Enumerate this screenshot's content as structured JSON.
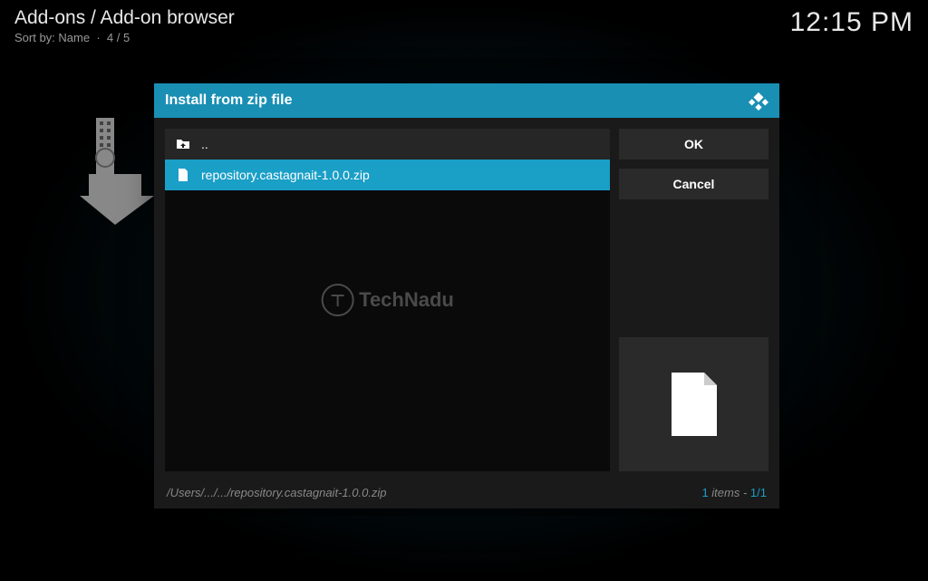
{
  "header": {
    "breadcrumb": "Add-ons / Add-on browser",
    "sort_label": "Sort by: Name",
    "sort_position": "4 / 5",
    "clock": "12:15 PM"
  },
  "dialog": {
    "title": "Install from zip file",
    "ok_label": "OK",
    "cancel_label": "Cancel",
    "parent_label": "..",
    "items": [
      {
        "name": "repository.castagnait-1.0.0.zip",
        "selected": true
      }
    ],
    "footer_path": "/Users/.../.../repository.castagnait-1.0.0.zip",
    "footer_items_word": "items -",
    "footer_count_num": "1",
    "footer_count_pos": "1/1"
  },
  "watermark": {
    "text": "TechNadu"
  }
}
